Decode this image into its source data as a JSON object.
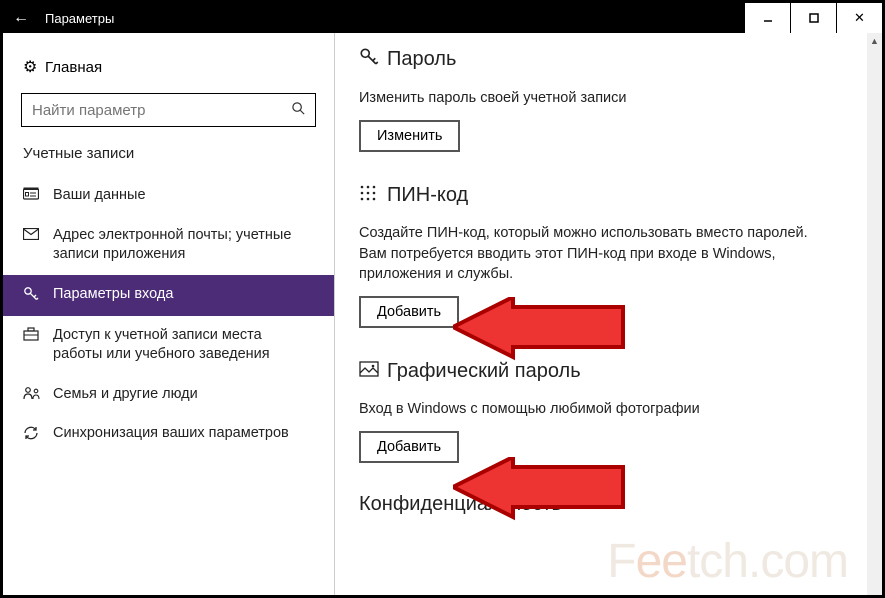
{
  "window": {
    "title": "Параметры"
  },
  "sidebar": {
    "home": "Главная",
    "search_placeholder": "Найти параметр",
    "group_title": "Учетные записи",
    "items": [
      {
        "label": "Ваши данные"
      },
      {
        "label": "Адрес электронной почты; учетные записи приложения"
      },
      {
        "label": "Параметры входа"
      },
      {
        "label": "Доступ к учетной записи места работы или учебного заведения"
      },
      {
        "label": "Семья и другие люди"
      },
      {
        "label": "Синхронизация ваших параметров"
      }
    ]
  },
  "content": {
    "password": {
      "title": "Пароль",
      "desc": "Изменить пароль своей учетной записи",
      "button": "Изменить"
    },
    "pin": {
      "title": "ПИН-код",
      "desc": "Создайте ПИН-код, который можно использовать вместо паролей. Вам потребуется вводить этот ПИН-код при входе в Windows, приложения и службы.",
      "button": "Добавить"
    },
    "picture": {
      "title": "Графический пароль",
      "desc": "Вход в Windows с помощью любимой фотографии",
      "button": "Добавить"
    },
    "partial_next": "Конфиденциальность"
  },
  "watermark": "Feetch.com"
}
